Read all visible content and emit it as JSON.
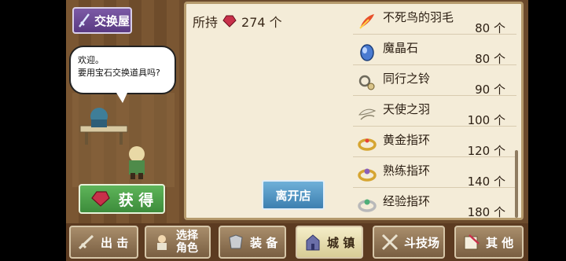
{
  "shop": {
    "title": "交换屋"
  },
  "npc": {
    "greeting_line1": "欢迎。",
    "greeting_line2": "要用宝石交换道具吗?"
  },
  "buttons": {
    "gain": "获 得",
    "leave": "离开店"
  },
  "currency": {
    "label": "所持",
    "amount": "274 个",
    "icon": "red-gem-icon"
  },
  "items": [
    {
      "name": "不死鸟的羽毛",
      "price": "80 个",
      "icon": "phoenix-feather-icon",
      "color": "#e8502a"
    },
    {
      "name": "魔晶石",
      "price": "80 个",
      "icon": "magic-crystal-icon",
      "color": "#4a7bd1"
    },
    {
      "name": "同行之铃",
      "price": "90 个",
      "icon": "companion-bell-icon",
      "color": "#9a8a6a"
    },
    {
      "name": "天使之羽",
      "price": "100 个",
      "icon": "angel-feather-icon",
      "color": "#e8e2d0"
    },
    {
      "name": "黄金指环",
      "price": "120 个",
      "icon": "gold-ring-icon",
      "color": "#d6a531"
    },
    {
      "name": "熟练指环",
      "price": "140 个",
      "icon": "skill-ring-icon",
      "color": "#8a5fb8"
    },
    {
      "name": "经验指环",
      "price": "180 个",
      "icon": "exp-ring-icon",
      "color": "#4fae78"
    }
  ],
  "tabs": [
    {
      "label": "出 击",
      "icon": "sortie-icon"
    },
    {
      "label1": "选择",
      "label2": "角色",
      "icon": "select-character-icon"
    },
    {
      "label": "装 备",
      "icon": "equipment-icon"
    },
    {
      "label": "城 镇",
      "icon": "town-icon",
      "active": true
    },
    {
      "label": "斗技场",
      "icon": "arena-icon"
    },
    {
      "label": "其 他",
      "icon": "other-icon"
    }
  ]
}
